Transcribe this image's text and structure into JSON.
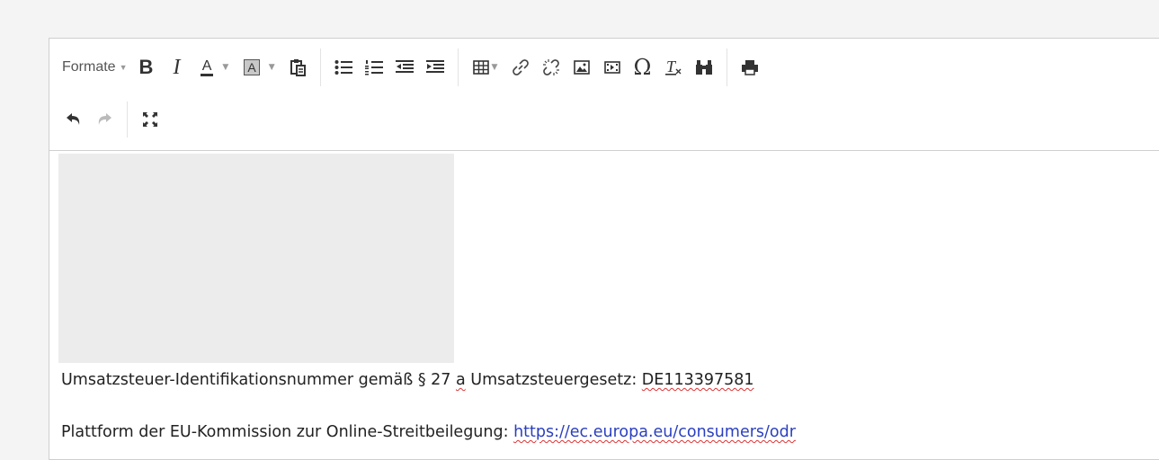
{
  "toolbar": {
    "formats_label": "Formate",
    "row1_icons": [
      "bold-icon",
      "italic-icon",
      "text-color-icon",
      "background-color-icon",
      "paste-icon",
      "bullet-list-icon",
      "numbered-list-icon",
      "outdent-icon",
      "indent-icon",
      "table-icon",
      "link-icon",
      "unlink-icon",
      "image-icon",
      "media-icon",
      "special-character-icon",
      "clear-formatting-icon",
      "find-replace-icon",
      "print-icon"
    ],
    "row2_icons": [
      "undo-icon",
      "redo-icon",
      "fullscreen-icon"
    ]
  },
  "content": {
    "vat_text_pre": "Umsatzsteuer-Identifikationsnummer gemäß § 27 ",
    "vat_text_a": "a",
    "vat_text_mid": " Umsatzsteuergesetz: ",
    "vat_number": "DE113397581",
    "odr_text": "Plattform der EU-Kommission zur Online-Streitbeilegung: ",
    "odr_link": "https://ec.europa.eu/consumers/odr"
  },
  "colors": {
    "background": "#f4f4f5",
    "link": "#2a3fbf",
    "spellcheck": "#dd3333",
    "placeholder": "#ececec"
  }
}
